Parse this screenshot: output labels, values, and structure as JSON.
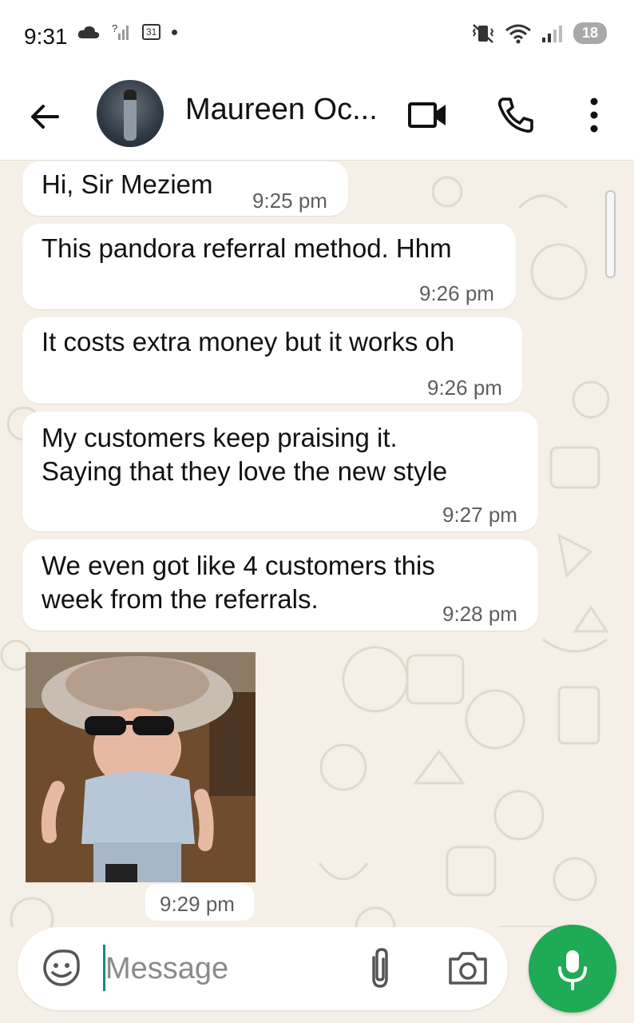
{
  "status_bar": {
    "time": "9:31",
    "calendar_day": "31",
    "battery": "18",
    "icons": [
      "cloud-icon",
      "no-signal-icon",
      "calendar-icon",
      "notification-dot",
      "vibrate-icon",
      "wifi-icon",
      "signal-icon",
      "battery-icon"
    ]
  },
  "header": {
    "contact_name": "Maureen Oc...",
    "icons": [
      "back-arrow-icon",
      "video-call-icon",
      "phone-icon",
      "more-vert-icon"
    ]
  },
  "messages": [
    {
      "text_lines": [
        "Hi, Sir Meziem"
      ],
      "time": "9:25 pm"
    },
    {
      "text_lines": [
        "This pandora referral method. Hhm"
      ],
      "time": "9:26 pm"
    },
    {
      "text_lines": [
        "It costs extra money but it works oh"
      ],
      "time": "9:26 pm"
    },
    {
      "text_lines": [
        "My customers keep praising it.",
        "Saying that they love the new style"
      ],
      "time": "9:27 pm"
    },
    {
      "text_lines": [
        "We even got like 4 customers this",
        "week from the referrals."
      ],
      "time": "9:28 pm"
    },
    {
      "type": "image",
      "description_icon": "photo-message",
      "time": "9:29 pm"
    }
  ],
  "composer": {
    "placeholder": "Message",
    "icons": [
      "emoji-sticker-icon",
      "attach-icon",
      "camera-icon",
      "mic-icon"
    ]
  },
  "colors": {
    "chat_background": "#f4efe7",
    "bubble": "#ffffff",
    "accent_green": "#1faa55",
    "cursor_teal": "#128c7e"
  }
}
